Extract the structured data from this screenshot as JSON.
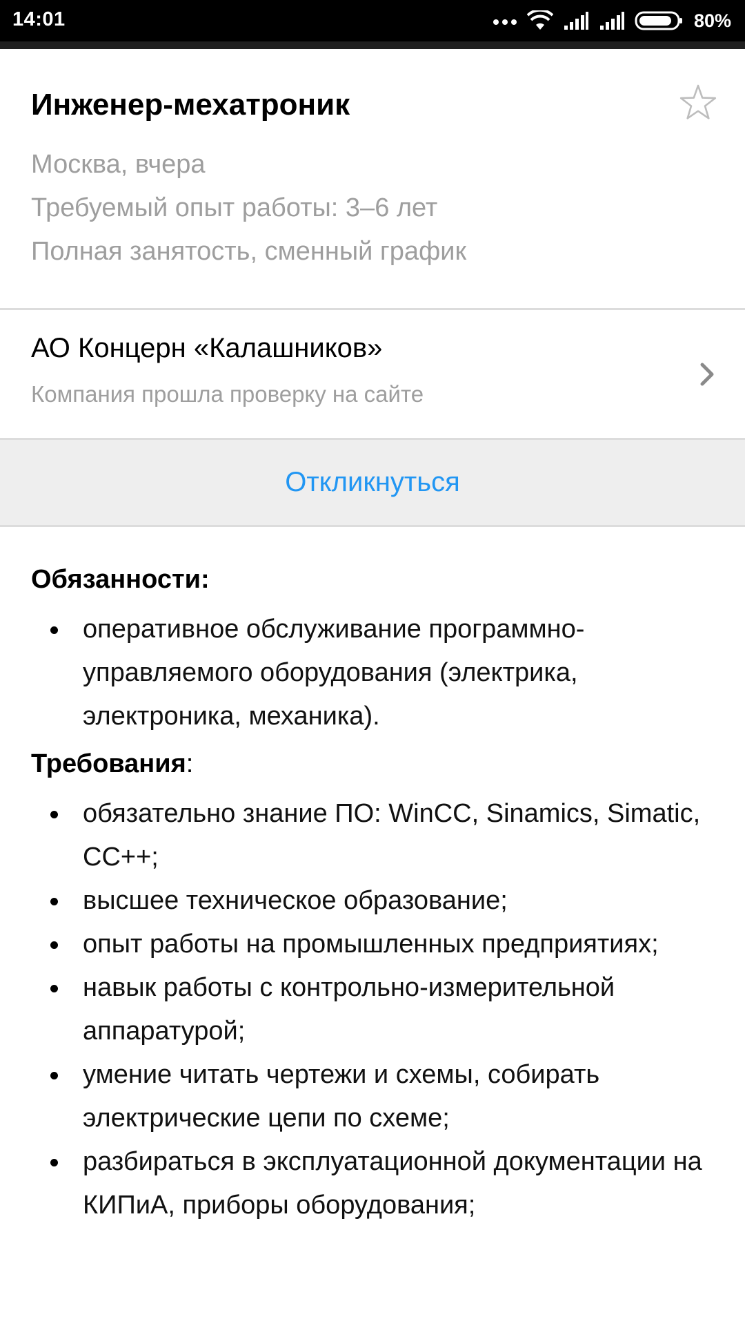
{
  "status_bar": {
    "time": "14:01",
    "battery_percent": "80%",
    "icons": [
      "more-dots-icon",
      "wifi-icon",
      "signal-icon",
      "signal-icon",
      "battery-icon"
    ]
  },
  "vacancy": {
    "title": "Инженер-мехатроник",
    "location_date": "Москва, вчера",
    "experience": "Требуемый опыт работы: 3–6 лет",
    "schedule": "Полная занятость, сменный график",
    "favorite_icon": "star-outline-icon"
  },
  "company": {
    "name": "АО Концерн «Калашников»",
    "verified_text": "Компания прошла проверку на сайте",
    "chevron_icon": "chevron-right-icon"
  },
  "actions": {
    "respond_label": "Откликнуться",
    "accent_color": "#2196f3"
  },
  "description": {
    "duties_heading": "Обязанности:",
    "duties": [
      "оперативное обслуживание программно-управляемого оборудования (электрика, электроника, механика)."
    ],
    "requirements_heading": "Требования",
    "requirements_colon": ":",
    "requirements": [
      "обязательно знание ПО: WinCC, Sinamics, Simatic, CC++;",
      "высшее техническое образование;",
      "опыт работы на промышленных предприятиях;",
      "навык работы с контрольно-измерительной аппаратурой;",
      "умение читать чертежи и схемы, собирать электрические цепи по схеме;",
      "разбираться в эксплуатационной документации на КИПиА, приборы оборудования;"
    ]
  }
}
